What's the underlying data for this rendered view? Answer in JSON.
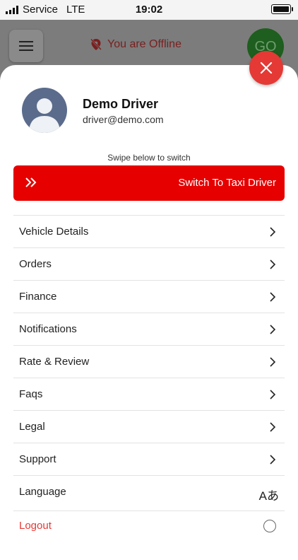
{
  "status_bar": {
    "carrier": "Service",
    "network": "LTE",
    "time": "19:02"
  },
  "header": {
    "offline_text": "You are Offline",
    "go_label": "GO"
  },
  "profile": {
    "name": "Demo Driver",
    "email": "driver@demo.com"
  },
  "switch": {
    "hint": "Swipe below to switch",
    "label": "Switch To Taxi Driver"
  },
  "menu": {
    "items": [
      {
        "label": "Vehicle Details"
      },
      {
        "label": "Orders"
      },
      {
        "label": "Finance"
      },
      {
        "label": "Notifications"
      },
      {
        "label": "Rate & Review"
      },
      {
        "label": "Faqs"
      },
      {
        "label": "Legal"
      },
      {
        "label": "Support"
      }
    ],
    "language_label": "Language",
    "language_icon_text": "Aあ",
    "logout_label": "Logout"
  },
  "colors": {
    "accent_red": "#e60000",
    "close_red": "#e53935",
    "go_green": "#1e5e1e"
  }
}
